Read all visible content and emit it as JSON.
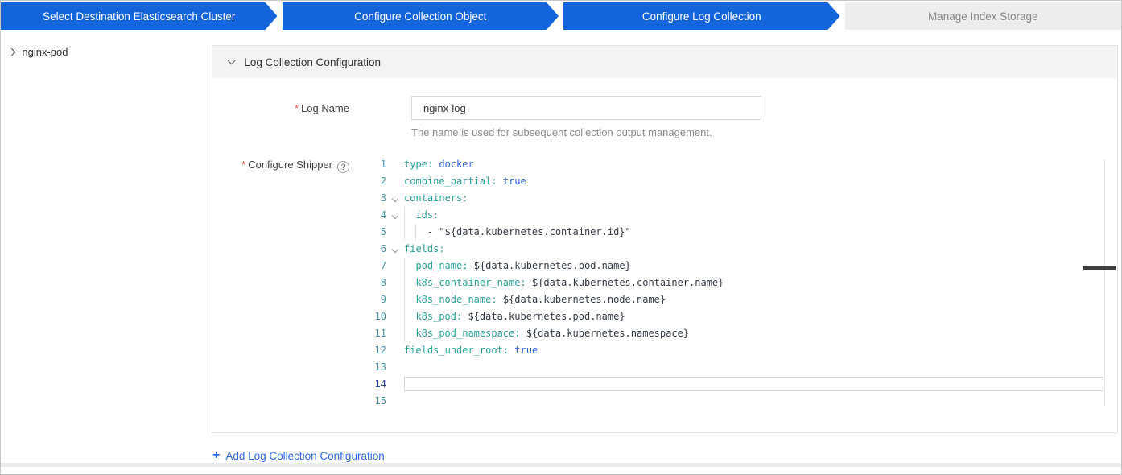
{
  "colors": {
    "step_blue": "#1465dc",
    "step_pending_bg": "#ededed",
    "step_pending_text": "#878787",
    "link_blue": "#2f6be5",
    "required_red": "#e34d4d",
    "code_key": "#2aa198",
    "code_value": "#2d5fd9",
    "code_text": "#333333",
    "gutter_number": "#4791a6",
    "gutter_number_active": "#24418f"
  },
  "steps": [
    {
      "label": "Select Destination Elasticsearch Cluster",
      "state": "done"
    },
    {
      "label": "Configure Collection Object",
      "state": "done"
    },
    {
      "label": "Configure Log Collection",
      "state": "active"
    },
    {
      "label": "Manage Index Storage",
      "state": "pending"
    }
  ],
  "sidebar": {
    "items": [
      {
        "label": "nginx-pod"
      }
    ]
  },
  "panel": {
    "header": "Log Collection Configuration",
    "log_name": {
      "label": "Log Name",
      "required": "*",
      "value": "nginx-log",
      "help": "The name is used for subsequent collection output management."
    },
    "shipper": {
      "label": "Configure Shipper",
      "required": "*",
      "help_icon": "?"
    }
  },
  "editor": {
    "lines": [
      {
        "num": 1,
        "fold": false,
        "guides": 0,
        "tokens": [
          [
            "k",
            "type"
          ],
          [
            "p",
            ":"
          ],
          [
            "t",
            " "
          ],
          [
            "v",
            "docker"
          ]
        ]
      },
      {
        "num": 2,
        "fold": false,
        "guides": 0,
        "tokens": [
          [
            "k",
            "combine_partial"
          ],
          [
            "p",
            ":"
          ],
          [
            "t",
            " "
          ],
          [
            "v",
            "true"
          ]
        ]
      },
      {
        "num": 3,
        "fold": true,
        "guides": 0,
        "tokens": [
          [
            "k",
            "containers"
          ],
          [
            "p",
            ":"
          ]
        ]
      },
      {
        "num": 4,
        "fold": true,
        "guides": 1,
        "tokens": [
          [
            "k",
            "ids"
          ],
          [
            "p",
            ":"
          ]
        ]
      },
      {
        "num": 5,
        "fold": false,
        "guides": 2,
        "tokens": [
          [
            "d",
            "- "
          ],
          [
            "s",
            "\"${data.kubernetes.container.id}\""
          ]
        ]
      },
      {
        "num": 6,
        "fold": true,
        "guides": 0,
        "tokens": [
          [
            "k",
            "fields"
          ],
          [
            "p",
            ":"
          ]
        ]
      },
      {
        "num": 7,
        "fold": false,
        "guides": 1,
        "tokens": [
          [
            "k",
            "pod_name"
          ],
          [
            "p",
            ":"
          ],
          [
            "t",
            " "
          ],
          [
            "s",
            "${data.kubernetes.pod.name}"
          ]
        ]
      },
      {
        "num": 8,
        "fold": false,
        "guides": 1,
        "tokens": [
          [
            "k",
            "k8s_container_name"
          ],
          [
            "p",
            ":"
          ],
          [
            "t",
            " "
          ],
          [
            "s",
            "${data.kubernetes.container.name}"
          ]
        ]
      },
      {
        "num": 9,
        "fold": false,
        "guides": 1,
        "tokens": [
          [
            "k",
            "k8s_node_name"
          ],
          [
            "p",
            ":"
          ],
          [
            "t",
            " "
          ],
          [
            "s",
            "${data.kubernetes.node.name}"
          ]
        ]
      },
      {
        "num": 10,
        "fold": false,
        "guides": 1,
        "tokens": [
          [
            "k",
            "k8s_pod"
          ],
          [
            "p",
            ":"
          ],
          [
            "t",
            " "
          ],
          [
            "s",
            "${data.kubernetes.pod.name}"
          ]
        ]
      },
      {
        "num": 11,
        "fold": false,
        "guides": 1,
        "tokens": [
          [
            "k",
            "k8s_pod_namespace"
          ],
          [
            "p",
            ":"
          ],
          [
            "t",
            " "
          ],
          [
            "s",
            "${data.kubernetes.namespace}"
          ]
        ]
      },
      {
        "num": 12,
        "fold": false,
        "guides": 0,
        "tokens": [
          [
            "k",
            "fields_under_root"
          ],
          [
            "p",
            ":"
          ],
          [
            "t",
            " "
          ],
          [
            "v",
            "true"
          ]
        ]
      },
      {
        "num": 13,
        "fold": false,
        "guides": 0,
        "tokens": []
      },
      {
        "num": 14,
        "fold": false,
        "guides": 0,
        "active": true,
        "input": true,
        "tokens": []
      },
      {
        "num": 15,
        "fold": false,
        "guides": 0,
        "tokens": []
      }
    ]
  },
  "footer": {
    "add_link": "Add Log Collection Configuration",
    "plus_icon": "+"
  }
}
